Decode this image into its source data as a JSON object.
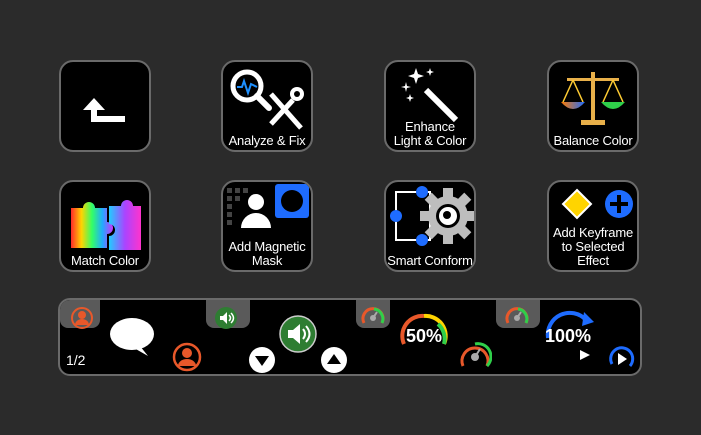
{
  "keys": [
    {
      "id": "back",
      "label": "",
      "icon": "back-arrow-icon"
    },
    {
      "id": "analyze",
      "label": "Analyze & Fix",
      "icon": "analyze-fix-icon"
    },
    {
      "id": "enhance",
      "label_line1": "Enhance",
      "label_line2": "Light & Color",
      "icon": "magic-wand-icon"
    },
    {
      "id": "balance",
      "label": "Balance Color",
      "icon": "scales-icon"
    },
    {
      "id": "match",
      "label": "Match Color",
      "icon": "puzzle-icon"
    },
    {
      "id": "mask",
      "label_line1": "Add Magnetic",
      "label_line2": "Mask",
      "icon": "magnetic-mask-icon"
    },
    {
      "id": "conform",
      "label": "Smart Conform",
      "icon": "smart-conform-icon"
    },
    {
      "id": "keyframe",
      "label_line1": "Add Keyframe",
      "label_line2": "to Selected",
      "label_line3": "Effect",
      "icon": "keyframe-icon"
    }
  ],
  "bar": {
    "pager": "1/2",
    "zoom_percent": "50%",
    "speed_percent": "100%"
  },
  "colors": {
    "background": "#2b2b2b",
    "key_border": "#6a6a6a",
    "accent_blue": "#1e90ff",
    "accent_orange": "#e8582a",
    "accent_green": "#2e7d32"
  }
}
